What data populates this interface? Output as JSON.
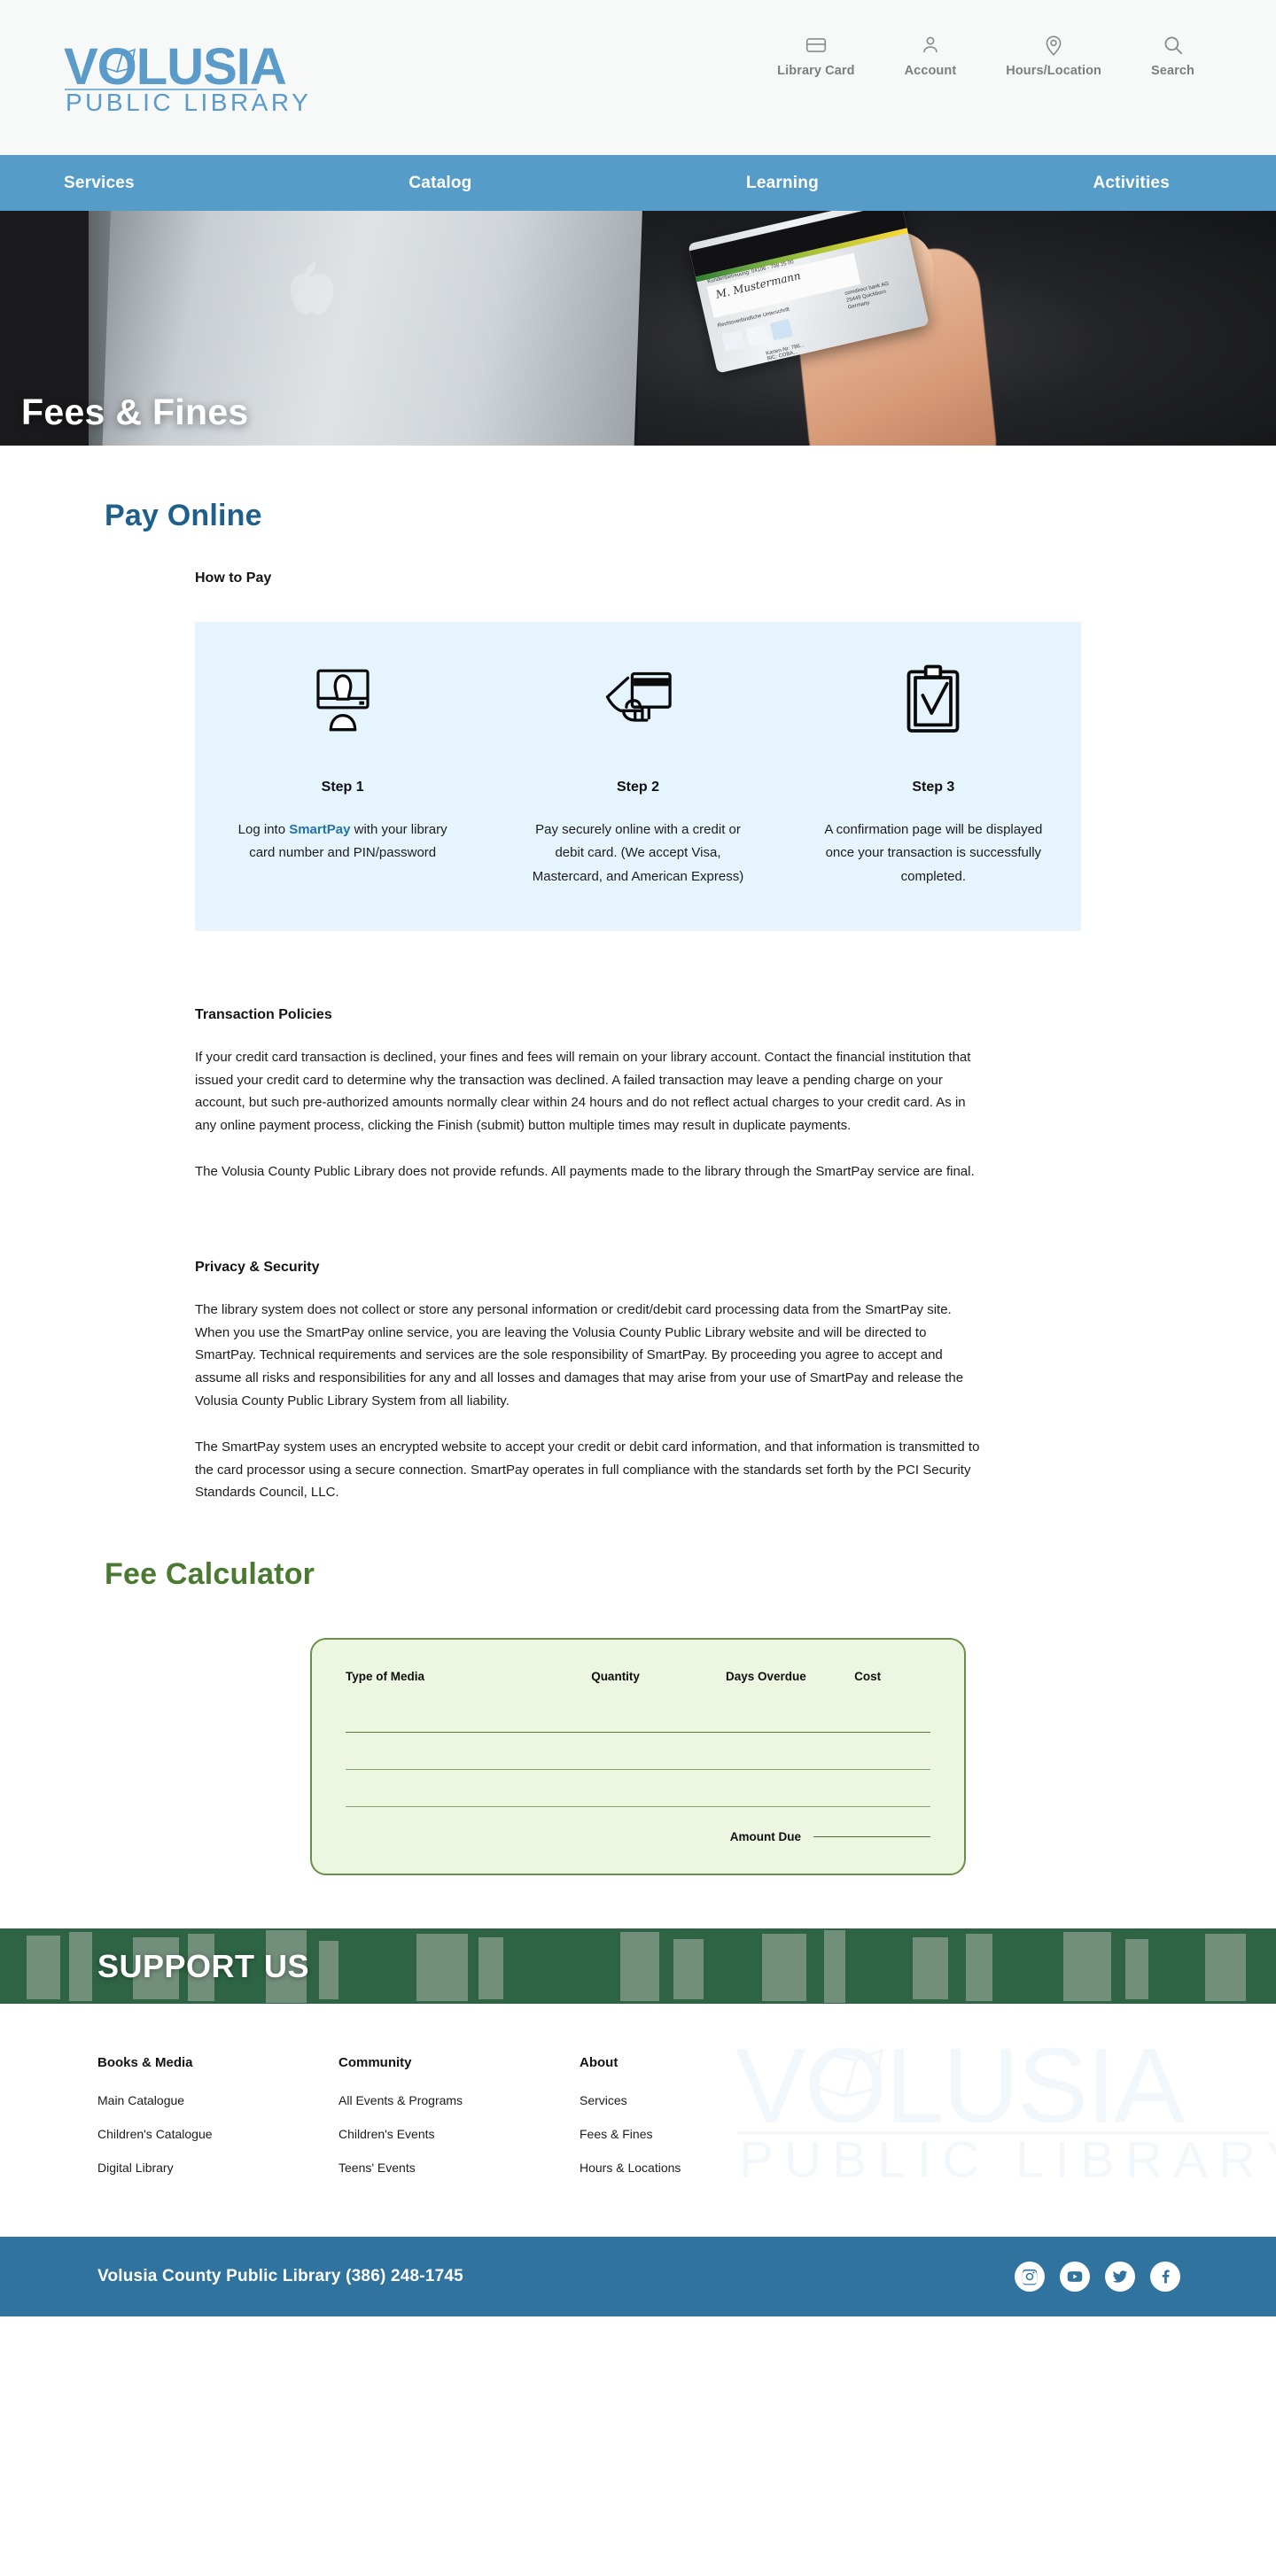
{
  "header": {
    "logo_primary": "VOLUSIA",
    "logo_secondary": "PUBLIC LIBRARY",
    "utility_nav": [
      {
        "label": "Library Card",
        "icon": "card-icon"
      },
      {
        "label": "Account",
        "icon": "user-icon"
      },
      {
        "label": "Hours/Location",
        "icon": "location-pin-icon"
      },
      {
        "label": "Search",
        "icon": "search-icon"
      }
    ]
  },
  "main_nav": [
    {
      "label": "Services"
    },
    {
      "label": "Catalog"
    },
    {
      "label": "Learning"
    },
    {
      "label": "Activities"
    }
  ],
  "hero": {
    "title": "Fees & Fines"
  },
  "pay_online": {
    "heading": "Pay Online",
    "sub_heading": "How to Pay",
    "steps": [
      {
        "icon": "computer-person-icon",
        "label": "Step 1",
        "text_before": "Log into ",
        "link": "SmartPay",
        "text_after": " with your library card number and PIN/password"
      },
      {
        "icon": "hand-credit-card-icon",
        "label": "Step 2",
        "text_before": "Pay securely online with a credit or debit card. (We accept Visa, Mastercard, and American Express)",
        "link": "",
        "text_after": ""
      },
      {
        "icon": "clipboard-check-icon",
        "label": "Step 3",
        "text_before": "A confirmation page will be displayed once your transaction is successfully completed.",
        "link": "",
        "text_after": ""
      }
    ]
  },
  "transaction_policies": {
    "heading": "Transaction Policies",
    "paragraph_1": "If your credit card transaction is declined, your fines and fees will remain on your library account. Contact the financial institution that issued your credit card to determine why the transaction was declined. A failed transaction may leave a pending charge on your account, but such pre-authorized amounts normally clear within 24 hours and do not reflect actual charges to your credit card. As in any online payment process, clicking the Finish (submit) button multiple times may result in duplicate payments.",
    "paragraph_2": "The Volusia County Public Library does not provide refunds. All payments made to the library through the SmartPay service are final."
  },
  "privacy_security": {
    "heading": "Privacy & Security",
    "paragraph_1": "The library system does not collect or store any personal information or credit/debit card processing data from the SmartPay site. When you use the SmartPay online service, you are leaving the Volusia County Public Library website and will be directed to SmartPay. Technical requirements and services are the sole responsibility of SmartPay. By proceeding you agree to accept and assume all risks and responsibilities for any and all losses and damages that may arise from your use of SmartPay and release the Volusia County Public Library System from all liability.",
    "paragraph_2": "The SmartPay system uses an encrypted website to accept your credit or debit card information, and that information is transmitted to the card processor using a secure connection. SmartPay operates in full compliance with the standards set forth by the PCI Security Standards Council, LLC."
  },
  "fee_calculator": {
    "heading": "Fee Calculator",
    "columns": [
      "Type of Media",
      "Quantity",
      "Days Overdue",
      "Cost"
    ],
    "rows": [
      [
        "",
        "",
        "",
        ""
      ],
      [
        "",
        "",
        "",
        ""
      ],
      [
        "",
        "",
        "",
        ""
      ]
    ],
    "total_label": "Amount Due",
    "total_value": ""
  },
  "support": {
    "title": "SUPPORT US"
  },
  "footer": {
    "columns": [
      {
        "title": "Books & Media",
        "links": [
          "Main Catalogue",
          "Children's Catalogue",
          "Digital Library"
        ]
      },
      {
        "title": "Community",
        "links": [
          "All Events & Programs",
          "Children's Events",
          "Teens' Events"
        ]
      },
      {
        "title": "About",
        "links": [
          "Services",
          "Fees & Fines",
          "Hours & Locations"
        ]
      }
    ],
    "watermark_primary": "VOLUSIA",
    "watermark_secondary": "PUBLIC LIBRARY"
  },
  "bottom_bar": {
    "text": "Volusia County Public Library (386) 248-1745",
    "socials": [
      {
        "name": "instagram-icon"
      },
      {
        "name": "youtube-icon"
      },
      {
        "name": "twitter-icon"
      },
      {
        "name": "facebook-icon"
      }
    ]
  },
  "colors": {
    "brand_blue": "#559cc8",
    "heading_blue": "#1f5f8b",
    "heading_green": "#4a7a31",
    "steps_bg": "#e6f4fd",
    "calc_bg": "#edf6e0",
    "footer_blue": "#30739f",
    "support_green": "#2e6444"
  }
}
